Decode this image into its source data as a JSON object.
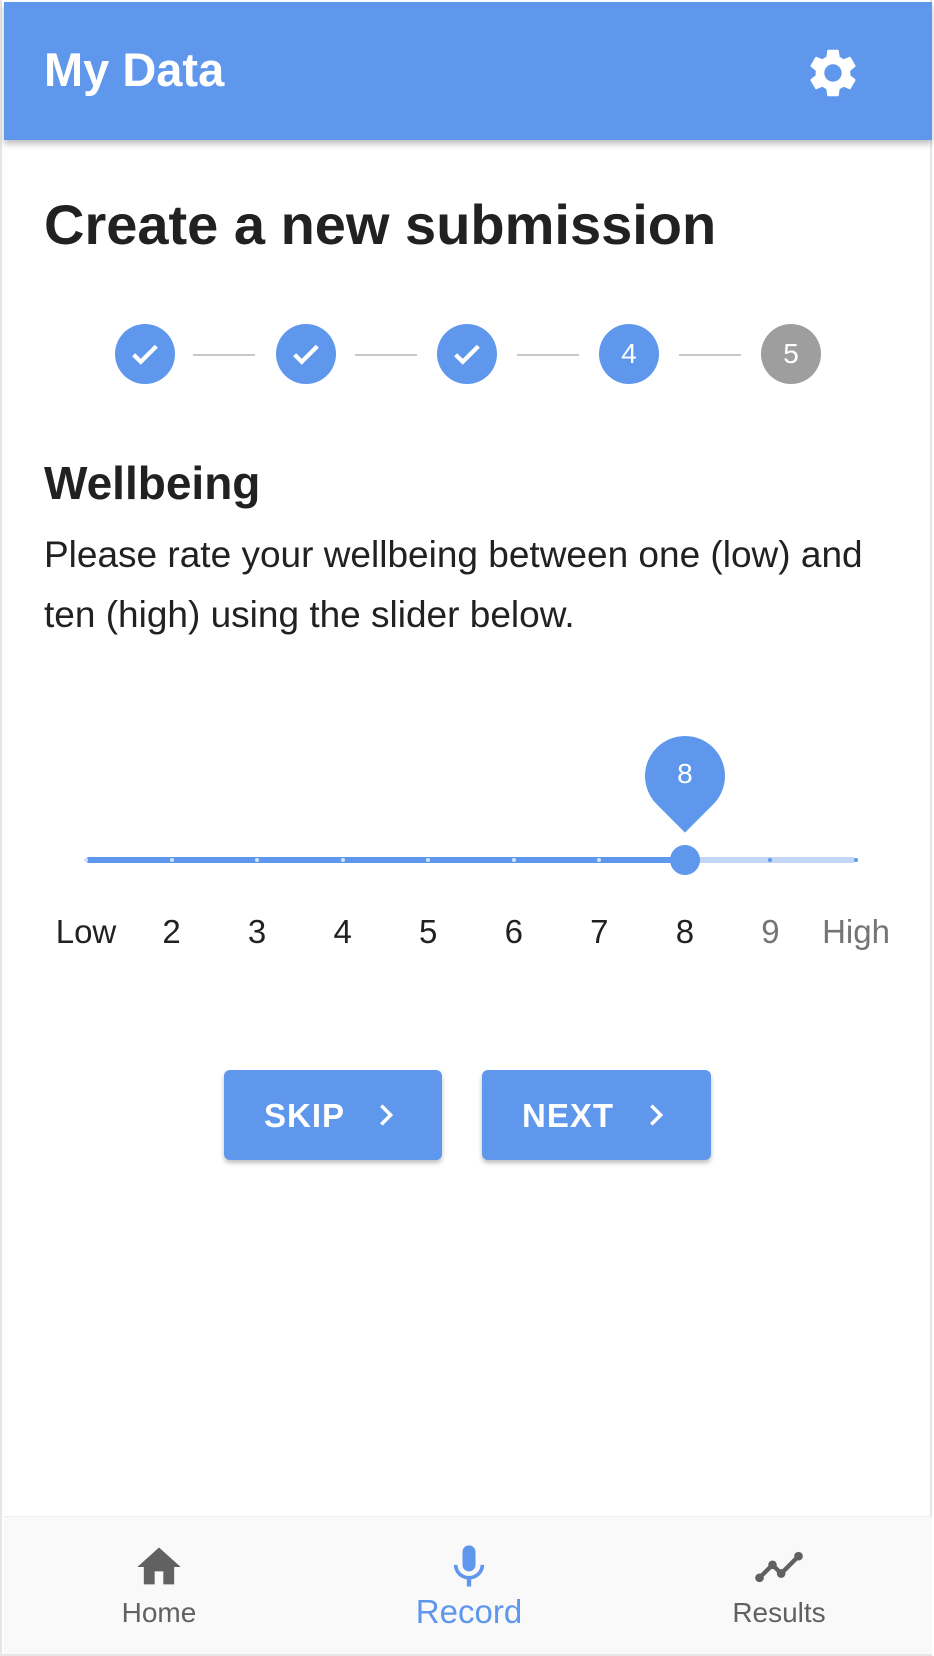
{
  "app": {
    "title": "My Data",
    "accent_color": "#5f97ec",
    "settings_icon": "gear-icon"
  },
  "page": {
    "title": "Create a new submission"
  },
  "stepper": {
    "steps": [
      {
        "status": "complete",
        "icon": "check-icon"
      },
      {
        "status": "complete",
        "icon": "check-icon"
      },
      {
        "status": "complete",
        "icon": "check-icon"
      },
      {
        "status": "active",
        "label": "4"
      },
      {
        "status": "pending",
        "label": "5"
      }
    ]
  },
  "question": {
    "title": "Wellbeing",
    "description": "Please rate your wellbeing between one (low) and ten (high) using the slider below."
  },
  "slider": {
    "min": 1,
    "max": 10,
    "value": 8,
    "value_label": "8",
    "labels": [
      "Low",
      "2",
      "3",
      "4",
      "5",
      "6",
      "7",
      "8",
      "9",
      "High"
    ]
  },
  "actions": {
    "skip_label": "SKIP",
    "next_label": "NEXT"
  },
  "bottom_nav": {
    "items": [
      {
        "label": "Home",
        "icon": "home-icon",
        "active": false
      },
      {
        "label": "Record",
        "icon": "microphone-icon",
        "active": true
      },
      {
        "label": "Results",
        "icon": "line-chart-icon",
        "active": false
      }
    ]
  }
}
